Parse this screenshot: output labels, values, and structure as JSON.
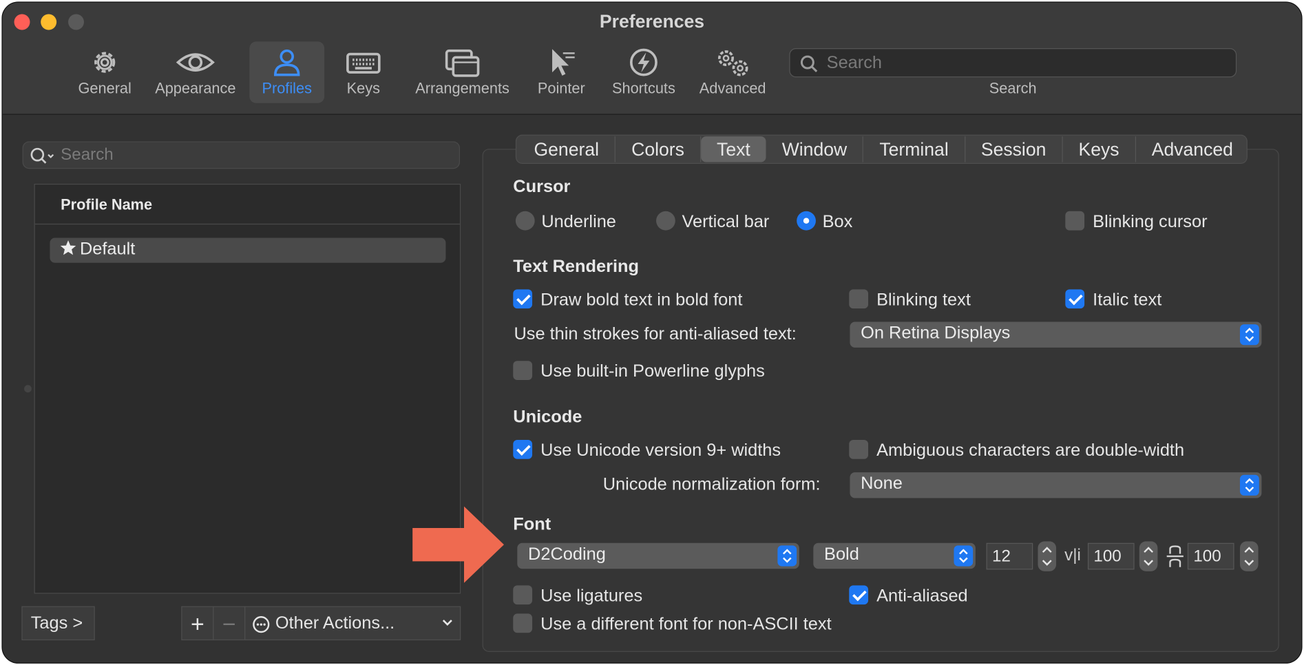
{
  "window": {
    "title": "Preferences"
  },
  "toolbar": {
    "items": [
      {
        "label": "General",
        "icon": "gear-icon"
      },
      {
        "label": "Appearance",
        "icon": "eye-icon"
      },
      {
        "label": "Profiles",
        "icon": "person-icon",
        "active": true
      },
      {
        "label": "Keys",
        "icon": "keyboard-icon"
      },
      {
        "label": "Arrangements",
        "icon": "windows-icon"
      },
      {
        "label": "Pointer",
        "icon": "pointer-icon"
      },
      {
        "label": "Shortcuts",
        "icon": "bolt-icon"
      },
      {
        "label": "Advanced",
        "icon": "gears-icon"
      }
    ],
    "search_placeholder": "Search",
    "search_label": "Search"
  },
  "left": {
    "search_placeholder": "Search",
    "column_header": "Profile Name",
    "profiles": [
      {
        "name": "Default",
        "icon": "star-icon"
      }
    ],
    "tags_button": "Tags >",
    "plus": "+",
    "minus": "−",
    "other_actions": "Other Actions..."
  },
  "tabs": [
    "General",
    "Colors",
    "Text",
    "Window",
    "Terminal",
    "Session",
    "Keys",
    "Advanced"
  ],
  "selected_tab": "Text",
  "cursor": {
    "title": "Cursor",
    "underline": "Underline",
    "vertical_bar": "Vertical bar",
    "box": "Box",
    "selected": "Box",
    "blinking": "Blinking cursor",
    "blinking_checked": false
  },
  "rendering": {
    "title": "Text Rendering",
    "bold": "Draw bold text in bold font",
    "bold_checked": true,
    "blinking_text": "Blinking text",
    "blinking_text_checked": false,
    "italic": "Italic text",
    "italic_checked": true,
    "thin_strokes_label": "Use thin strokes for anti-aliased text:",
    "thin_strokes_value": "On Retina Displays",
    "powerline": "Use built-in Powerline glyphs",
    "powerline_checked": false
  },
  "unicode": {
    "title": "Unicode",
    "v9": "Use Unicode version 9+ widths",
    "v9_checked": true,
    "ambiguous": "Ambiguous characters are double-width",
    "ambiguous_checked": false,
    "normalization_label": "Unicode normalization form:",
    "normalization_value": "None"
  },
  "font": {
    "title": "Font",
    "family": "D2Coding",
    "weight": "Bold",
    "size": "12",
    "h_spacing_icon": "v|i",
    "h_spacing": "100",
    "v_spacing_icon": "line-spacing-icon",
    "v_spacing": "100",
    "ligatures": "Use ligatures",
    "ligatures_checked": false,
    "antialiased": "Anti-aliased",
    "antialiased_checked": true,
    "non_ascii": "Use a different font for non-ASCII text",
    "non_ascii_checked": false
  },
  "colors": {
    "accent": "#1f78f2",
    "annotation_arrow": "#ef6a50",
    "active_tab_text": "#3d8ef7"
  }
}
